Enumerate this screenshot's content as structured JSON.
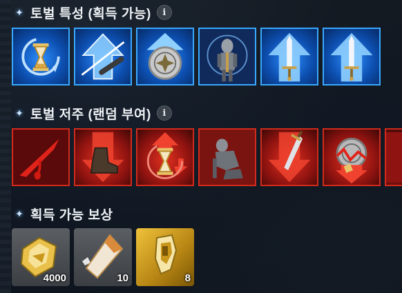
{
  "sections": {
    "traits": {
      "title": "토벌 특성 (획득 가능)",
      "info_icon": "i"
    },
    "curses": {
      "title": "토벌 저주 (랜덤 부여)",
      "info_icon": "i"
    },
    "rewards": {
      "title": "획득 가능 보상"
    }
  },
  "trait_icons": [
    "hourglass-cycle-icon",
    "sword-slash-up-icon",
    "emblem-up-icon",
    "armored-knight-icon",
    "sword-up-icon",
    "sword-up-icon"
  ],
  "curse_icons": [
    "blood-drip-icon",
    "boot-down-icon",
    "hourglass-up-icon",
    "kneeling-knight-icon",
    "dagger-down-icon",
    "shield-broken-icon"
  ],
  "rewards": [
    {
      "icon": "gold-crystal-icon",
      "count": "4000"
    },
    {
      "icon": "honing-stone-icon",
      "count": "10"
    },
    {
      "icon": "gold-fragment-icon",
      "count": "8"
    }
  ],
  "colors": {
    "trait_border": "#3aa9ff",
    "curse_border": "#d12b1d",
    "reward_gold": "#f0c23a"
  }
}
